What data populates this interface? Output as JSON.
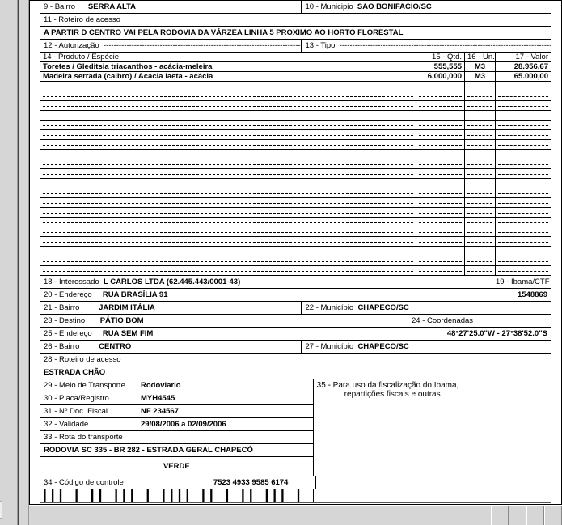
{
  "f9": {
    "label": "9 - Bairro",
    "value": "SERRA ALTA"
  },
  "f10": {
    "label": "10 - Municipio",
    "value": "SAO BONIFACIO/SC"
  },
  "f11": {
    "label": "11 - Roteiro de acesso"
  },
  "roteiro1": "A PARTIR D CENTRO VAI PELA RODOVIA DA VÁRZEA LINHA 5 PROXIMO AO HORTO FLORESTAL",
  "f12": {
    "label": "12 - Autorização"
  },
  "f13": {
    "label": "13 - Tipo"
  },
  "gridHeaders": {
    "c14": "14 - Produto / Espécie",
    "c15": "15 - Qtd.",
    "c16": "16 - Un.",
    "c17": "17 - Valor"
  },
  "items": [
    {
      "prod": "Toretes / Gleditsia triacanthos - acácia-meleira",
      "qtd": "555,555",
      "un": "M3",
      "val": "28.956,67"
    },
    {
      "prod": "Madeira serrada (caibro) / Acacia laeta - acácia",
      "qtd": "6.000,000",
      "un": "M3",
      "val": "65.000,00"
    }
  ],
  "emptyRows": 20,
  "f18": {
    "label": "18 - Interessado",
    "value": "L CARLOS LTDA (62.445.443/0001-43)"
  },
  "f19": {
    "label": "19 - Ibama/CTF",
    "value": "1548869"
  },
  "f20": {
    "label": "20 - Endereço",
    "value": "RUA BRASÍLIA 91"
  },
  "f21": {
    "label": "21 - Bairro",
    "value": "JARDIM ITÁLIA"
  },
  "f22": {
    "label": "22 - Município",
    "value": "CHAPECO/SC"
  },
  "f23": {
    "label": "23 - Destino",
    "value": "PÁTIO BOM"
  },
  "f24": {
    "label": "24 - Coordenadas",
    "value": "48°27'25.0\"W - 27°38'52.0\"S"
  },
  "f25": {
    "label": "25 - Endereço",
    "value": "RUA SEM FIM"
  },
  "f26": {
    "label": "26 - Bairro",
    "value": "CENTRO"
  },
  "f27": {
    "label": "27 - Município",
    "value": "CHAPECO/SC"
  },
  "f28": {
    "label": "28 - Roteiro de acesso"
  },
  "roteiro2": "ESTRADA CHÃO",
  "f29": {
    "label": "29 - Meio de Transporte",
    "value": "Rodoviario"
  },
  "f30": {
    "label": "30 - Placa/Registro",
    "value": "MYH4545"
  },
  "f31": {
    "label": "31 - Nº Doc. Fiscal",
    "value": "NF 234567"
  },
  "f32": {
    "label": "32 - Validade",
    "value": "29/08/2006 a 02/09/2006"
  },
  "f33": {
    "label": "33 - Rota do transporte"
  },
  "rota": "RODOVIA SC 335 - BR 282 - ESTRADA GERAL CHAPECÓ",
  "f35": {
    "label": "35 - Para uso da fiscalização do Ibama,",
    "label2": "repartições fiscais e outras"
  },
  "verde": "VERDE",
  "f34": {
    "label": "34 - Código de controle",
    "value": "7523 4933 9585 6174"
  },
  "barcode_glyphs": "||| | || ||| | |||| || | || ||| | || |||| | ||| || | || ||| | |||| || ||| | || |||",
  "tab": "ts"
}
